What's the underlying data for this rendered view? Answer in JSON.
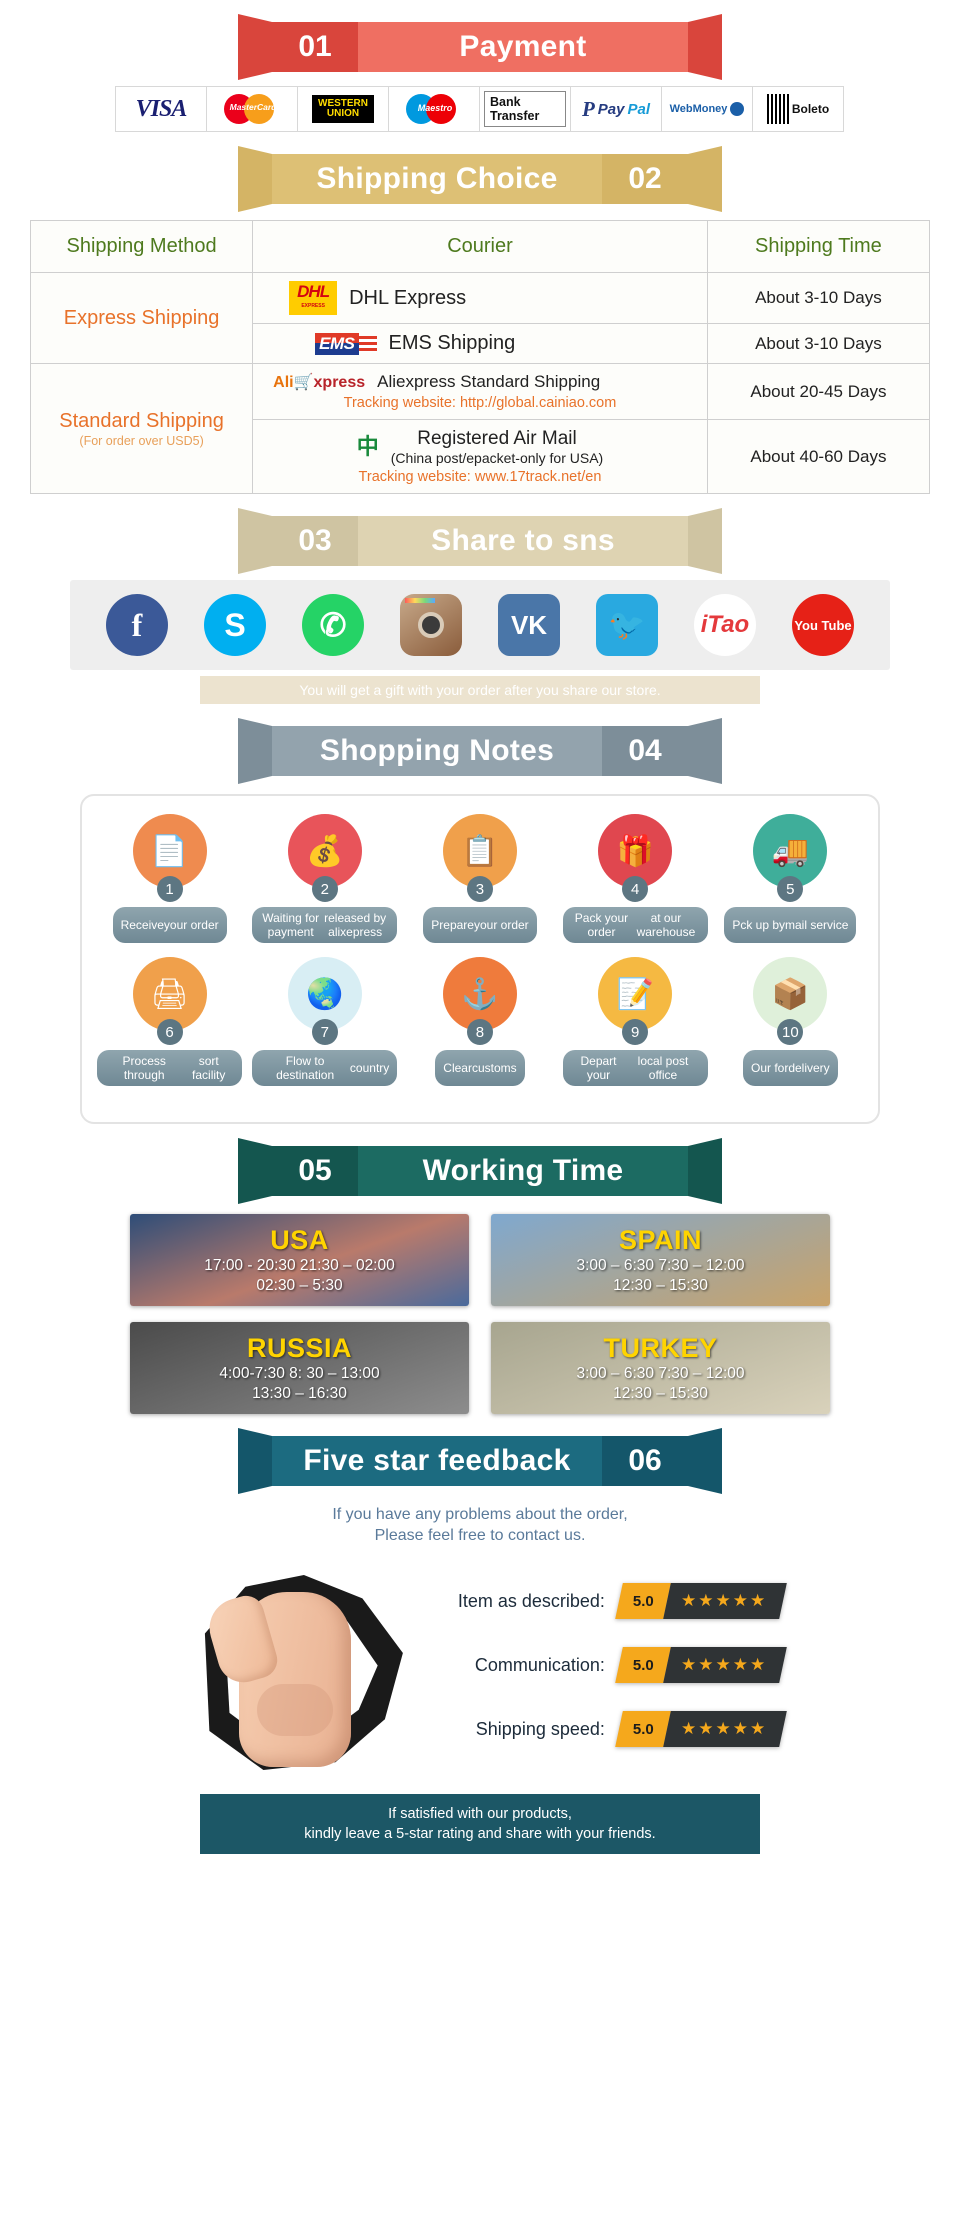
{
  "sections": {
    "payment": {
      "number": "01",
      "title": "Payment",
      "colors": {
        "dark": "#d9453c",
        "light": "#ef6f62"
      },
      "methods": [
        {
          "name": "visa",
          "label": "VISA"
        },
        {
          "name": "mastercard",
          "label": "MasterCard"
        },
        {
          "name": "western-union",
          "line1": "WESTERN",
          "line2": "UNION"
        },
        {
          "name": "maestro",
          "label": "Maestro"
        },
        {
          "name": "bank-transfer",
          "label": "Bank Transfer"
        },
        {
          "name": "paypal",
          "label_p": "Pay",
          "label_pal": "Pal"
        },
        {
          "name": "webmoney",
          "label": "WebMoney"
        },
        {
          "name": "boleto",
          "label": "Boleto"
        }
      ]
    },
    "shipping": {
      "number": "02",
      "title": "Shipping Choice",
      "colors": {
        "dark": "#d4b465",
        "light": "#ddc075"
      },
      "headers": [
        "Shipping Method",
        "Courier",
        "Shipping Time"
      ],
      "rows": [
        {
          "method": "Express Shipping",
          "method_sub": "",
          "couriers": [
            {
              "logo": "DHL",
              "logo_sub": "EXPRESS",
              "text": "DHL Express",
              "time": "About 3-10 Days"
            },
            {
              "logo": "EMS",
              "text": "EMS Shipping",
              "time": "About 3-10 Days"
            }
          ]
        },
        {
          "method": "Standard Shipping",
          "method_sub": "(For order over USD5)",
          "couriers": [
            {
              "logo": "AliExpress",
              "text": "Aliexpress Standard Shipping",
              "tracking": "Tracking website: http://global.cainiao.com",
              "time": "About 20-45 Days"
            },
            {
              "logo": "China Post",
              "text": "Registered Air Mail",
              "sub": "(China post/epacket-only for USA)",
              "tracking": "Tracking website: www.17track.net/en",
              "time": "About 40-60 Days"
            }
          ]
        }
      ]
    },
    "share": {
      "number": "03",
      "title": "Share to sns",
      "colors": {
        "dark": "#cfc4a2",
        "light": "#ded3b2"
      },
      "icons": [
        {
          "name": "facebook-icon",
          "glyph": "f"
        },
        {
          "name": "skype-icon",
          "glyph": "S"
        },
        {
          "name": "whatsapp-icon",
          "glyph": "✆"
        },
        {
          "name": "instagram-icon",
          "glyph": ""
        },
        {
          "name": "vk-icon",
          "glyph": "VK"
        },
        {
          "name": "twitter-icon",
          "glyph": "🐦"
        },
        {
          "name": "itao-icon",
          "glyph": "iTao"
        },
        {
          "name": "youtube-icon",
          "glyph": "You Tube"
        }
      ],
      "note": "You will get a gift with your order after you share our store."
    },
    "notes": {
      "number": "04",
      "title": "Shopping Notes",
      "colors": {
        "dark": "#7d8e99",
        "light": "#93a3ad"
      },
      "steps": [
        {
          "num": "1",
          "label": "Receive\nyour order",
          "icon": "document-icon",
          "color": "#ef8b4f"
        },
        {
          "num": "2",
          "label": "Waiting for payment\nreleased by alixepress",
          "icon": "money-bag-icon",
          "color": "#e8545a"
        },
        {
          "num": "3",
          "label": "Prepare\nyour order",
          "icon": "clipboard-icon",
          "color": "#f0a04b"
        },
        {
          "num": "4",
          "label": "Pack your order\nat our warehouse",
          "icon": "gift-box-icon",
          "color": "#e0474f"
        },
        {
          "num": "5",
          "label": "Pck up by\nmail service",
          "icon": "mail-truck-icon",
          "color": "#3fae9a"
        },
        {
          "num": "6",
          "label": "Process through\nsort facility",
          "icon": "scanner-icon",
          "color": "#f0a04b"
        },
        {
          "num": "7",
          "label": "Flow to destination\ncountry",
          "icon": "globe-icon",
          "color": "#d8eef4"
        },
        {
          "num": "8",
          "label": "Clear\ncustoms",
          "icon": "anchor-icon",
          "color": "#ef7b3c"
        },
        {
          "num": "9",
          "label": "Depart your\nlocal post office",
          "icon": "postman-icon",
          "color": "#f5b942"
        },
        {
          "num": "10",
          "label": "Our for\ndelivery",
          "icon": "package-icon",
          "color": "#dff0da"
        }
      ]
    },
    "working_time": {
      "number": "05",
      "title": "Working Time",
      "colors": {
        "dark": "#14564f",
        "light": "#1c6b62"
      },
      "cards": [
        {
          "country": "USA",
          "line1": "17:00  -  20:30   21:30  –  02:00",
          "line2": "02:30  –  5:30",
          "theme": "wt-usa"
        },
        {
          "country": "SPAIN",
          "line1": "3:00 –  6:30   7:30  –  12:00",
          "line2": "12:30  –  15:30",
          "theme": "wt-spain"
        },
        {
          "country": "RUSSIA",
          "line1": "4:00-7:30   8: 30  –  13:00",
          "line2": "13:30  –  16:30",
          "theme": "wt-russia"
        },
        {
          "country": "TURKEY",
          "line1": "3:00  –  6:30   7:30  –  12:00",
          "line2": "12:30  –  15:30",
          "theme": "wt-turkey"
        }
      ]
    },
    "feedback": {
      "number": "06",
      "title": "Five star feedback",
      "colors": {
        "dark": "#14566a",
        "light": "#1c6b80"
      },
      "intro_line1": "If you have any problems about the order,",
      "intro_line2": "Please feel free to contact us.",
      "ratings": [
        {
          "label": "Item as described:",
          "score": "5.0",
          "stars": "★★★★★"
        },
        {
          "label": "Communication:",
          "score": "5.0",
          "stars": "★★★★★"
        },
        {
          "label": "Shipping speed:",
          "score": "5.0",
          "stars": "★★★★★"
        }
      ],
      "footer_line1": "If satisfied with our products,",
      "footer_line2": "kindly leave a 5-star rating and share with your friends."
    }
  }
}
